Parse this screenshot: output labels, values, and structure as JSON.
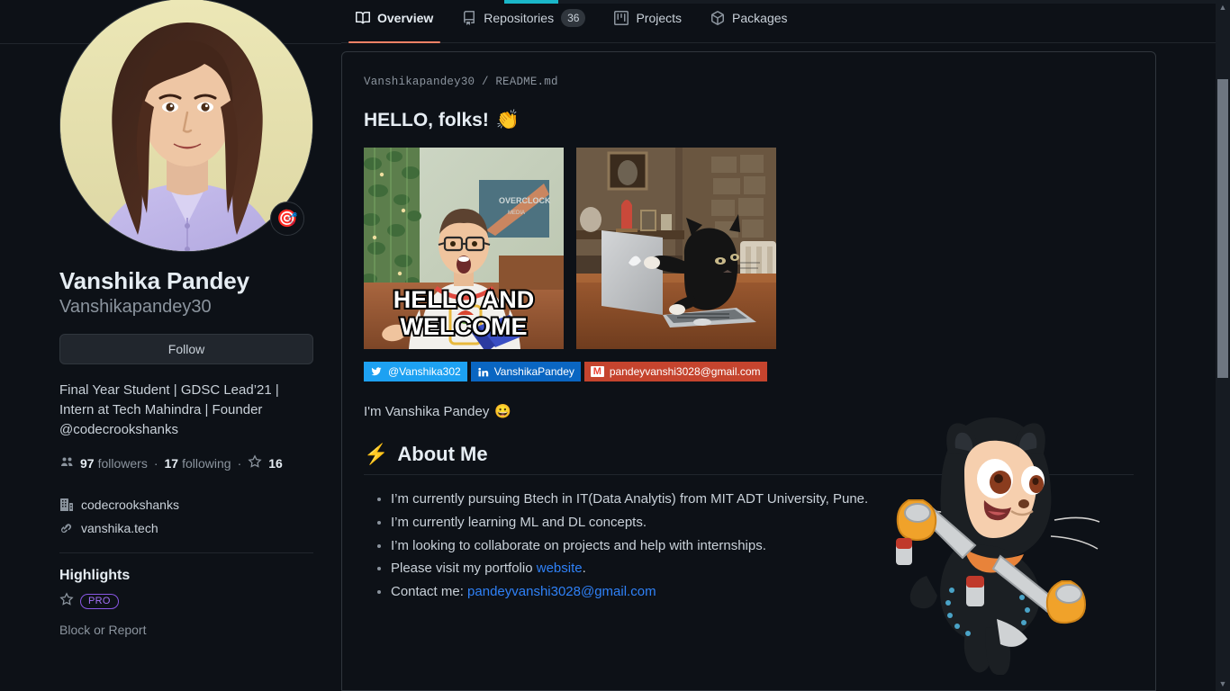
{
  "colors": {
    "background": "#0d1117",
    "border": "#30363d",
    "accent_tab_underline": "#f78166",
    "link": "#2f81f7",
    "pro_purple": "#a371f7",
    "loadbar": "#1ab7c9",
    "twitter": "#1da1f2",
    "linkedin": "#0a66c2",
    "gmail": "#c5442e"
  },
  "nav": {
    "tabs": [
      {
        "label": "Overview",
        "icon": "book-icon",
        "count": null,
        "active": true
      },
      {
        "label": "Repositories",
        "icon": "repo-icon",
        "count": "36",
        "active": false
      },
      {
        "label": "Projects",
        "icon": "project-icon",
        "count": null,
        "active": false
      },
      {
        "label": "Packages",
        "icon": "package-icon",
        "count": null,
        "active": false
      }
    ]
  },
  "profile": {
    "avatar_alt": "user-avatar-photo",
    "status_emoji": "🎯",
    "full_name": "Vanshika Pandey",
    "login": "Vanshikapandey30",
    "follow_label": "Follow",
    "bio": "Final Year Student | GDSC Lead’21 | Intern at Tech Mahindra | Founder @codecrookshanks",
    "stats": {
      "followers_count": "97",
      "followers_label": "followers",
      "following_count": "17",
      "following_label": "following",
      "stars_count": "16",
      "separator": "·"
    },
    "organization": "codecrookshanks",
    "website": "vanshika.tech",
    "highlights_title": "Highlights",
    "pro_badge": "PRO",
    "block_or_report": "Block or Report"
  },
  "readme": {
    "path_owner": "Vanshikapandey30",
    "path_sep": "/",
    "path_file": "README.md",
    "hello_heading": "HELLO, folks!",
    "hello_emoji": "👏",
    "gifs": [
      {
        "name": "hello-and-welcome-gif",
        "caption": "HELLO AND WELCOME"
      },
      {
        "name": "cat-typing-laptop-gif",
        "caption": ""
      }
    ],
    "badges": [
      {
        "name": "twitter-badge",
        "icon": "twitter-icon",
        "label": "@Vanshika302"
      },
      {
        "name": "linkedin-badge",
        "icon": "linkedin-icon",
        "label": "VanshikaPandey"
      },
      {
        "name": "gmail-badge",
        "icon": "gmail-icon",
        "label": "pandeyvanshi3028@gmail.com"
      }
    ],
    "intro_text": "I'm Vanshika Pandey",
    "intro_emoji": "😀",
    "about_emoji": "⚡",
    "about_heading": "About Me",
    "about_items": [
      {
        "text": "I’m currently pursuing Btech in IT(Data Analytis) from MIT ADT University, Pune.",
        "link": null,
        "suffix": ""
      },
      {
        "text": "I’m currently learning ML and DL concepts.",
        "link": null,
        "suffix": ""
      },
      {
        "text": "I’m looking to collaborate on projects and help with internships.",
        "link": null,
        "suffix": ""
      },
      {
        "text": "Please visit my portfolio ",
        "link": "website",
        "suffix": "."
      },
      {
        "text": "Contact me: ",
        "link": "pandeyvanshi3028@gmail.com",
        "suffix": ""
      }
    ]
  },
  "mascot": {
    "name": "octocat-mascot"
  },
  "scrollbar": {
    "up_arrow": "▲",
    "down_arrow": "▼"
  }
}
